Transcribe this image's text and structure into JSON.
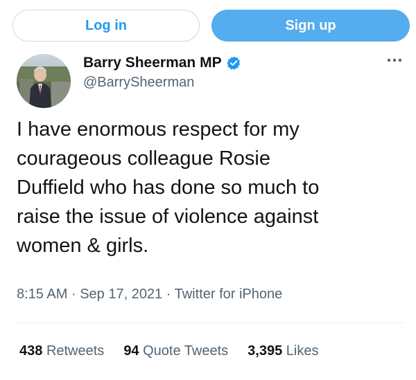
{
  "header": {
    "login_label": "Log in",
    "signup_label": "Sign up"
  },
  "author": {
    "name": "Barry Sheerman MP",
    "handle": "@BarrySheerman",
    "verified": true
  },
  "tweet": {
    "text": "I have enormous respect for my\ncourageous colleague Rosie\nDuffield who has done so much to\nraise the issue of violence against\nwomen & girls.",
    "time": "8:15 AM",
    "date": "Sep 17, 2021",
    "source": "Twitter for iPhone",
    "separator": "·"
  },
  "stats": {
    "retweets_count": "438",
    "retweets_label": "Retweets",
    "quotes_count": "94",
    "quotes_label": "Quote Tweets",
    "likes_count": "3,395",
    "likes_label": "Likes"
  },
  "colors": {
    "accent": "#1d9bf0",
    "signup_bg": "#55acee",
    "muted_text": "#536471",
    "primary_text": "#0f1419"
  },
  "icons": {
    "verified": "verified-badge-icon",
    "more": "more-options-icon"
  }
}
